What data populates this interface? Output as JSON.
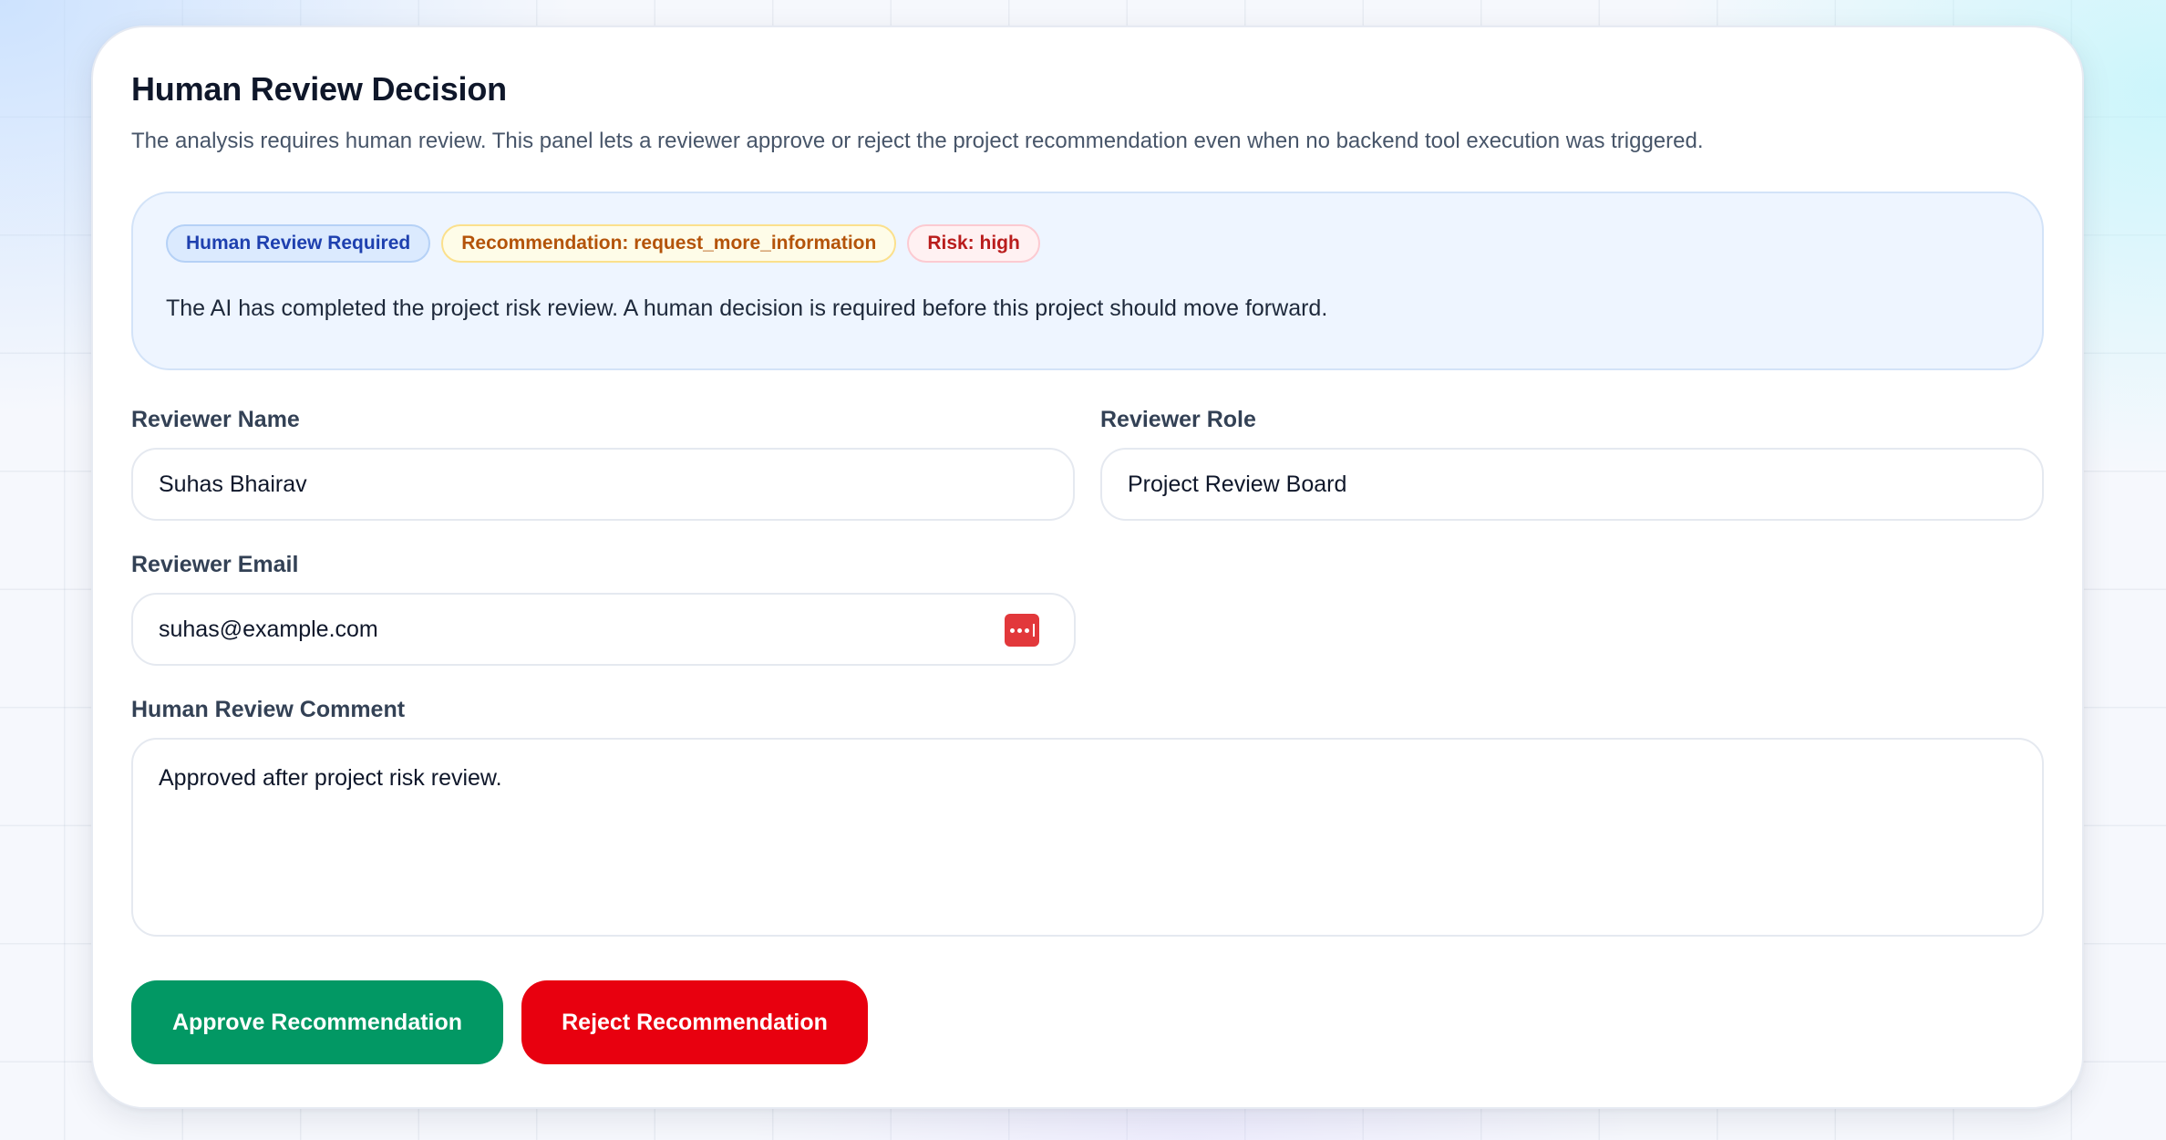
{
  "panel": {
    "title": "Human Review Decision",
    "subtitle": "The analysis requires human review. This panel lets a reviewer approve or reject the project recommendation even when no backend tool execution was triggered."
  },
  "summary": {
    "badges": [
      {
        "label": "Human Review Required",
        "color": "#1e40af"
      },
      {
        "label": "Recommendation: request_more_information",
        "color": "#b45309"
      },
      {
        "label": "Risk: high",
        "color": "#b91c1c"
      }
    ],
    "text": "The AI has completed the project risk review. A human decision is required before this project should move forward."
  },
  "form": {
    "reviewer_name": {
      "label": "Reviewer Name",
      "value": "Suhas Bhairav"
    },
    "reviewer_role": {
      "label": "Reviewer Role",
      "value": "Project Review Board"
    },
    "reviewer_email": {
      "label": "Reviewer Email",
      "value": "suhas@example.com",
      "icon": "password-manager-icon"
    },
    "comment": {
      "label": "Human Review Comment",
      "value": "Approved after project risk review."
    }
  },
  "actions": {
    "approve_label": "Approve Recommendation",
    "approve_color": "#029864",
    "reject_label": "Reject Recommendation",
    "reject_color": "#e8000f"
  }
}
